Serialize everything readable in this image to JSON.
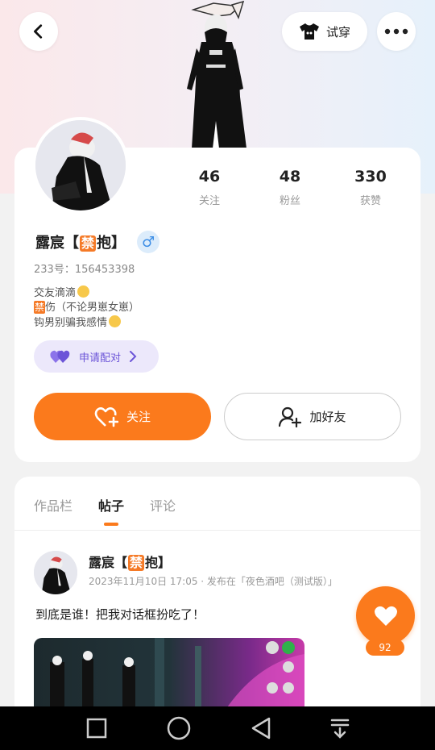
{
  "header": {
    "tryon_label": "试穿",
    "back_icon": "chevron-left-icon",
    "more_icon": "more-dots-icon",
    "tryon_icon": "tshirt-icon"
  },
  "profile": {
    "stats": [
      {
        "value": "46",
        "label": "关注"
      },
      {
        "value": "48",
        "label": "粉丝"
      },
      {
        "value": "330",
        "label": "获赞"
      }
    ],
    "name_prefix": "露宸【",
    "name_badge": "禁",
    "name_suffix": "抱】",
    "gender_symbol": "♂",
    "uid": "233号：156453398",
    "bio_line1": "交友滴滴",
    "bio_line2_badge": "禁",
    "bio_line2": "伤（不论男崽女崽）",
    "bio_line3": "钩男别骗我感情",
    "match_label": "申请配对",
    "follow_label": "关注",
    "add_friend_label": "加好友"
  },
  "tabs": [
    {
      "label": "作品栏",
      "active": false
    },
    {
      "label": "帖子",
      "active": true
    },
    {
      "label": "评论",
      "active": false
    }
  ],
  "post": {
    "author_prefix": "露宸【",
    "author_badge": "禁",
    "author_suffix": "抱】",
    "meta": "2023年11月10日 17:05 · 发布在「夜色酒吧（测试版）」",
    "text": "到底是谁！把我对话框扮吃了！",
    "like_count": "92"
  },
  "colors": {
    "accent": "#fb7a1c",
    "match_bg": "#ece8fb",
    "match_text": "#6c55d8",
    "gender_blue": "#3d8ee6"
  }
}
